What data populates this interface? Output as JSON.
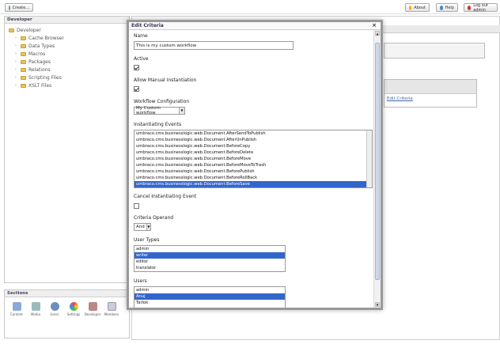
{
  "topbar": {
    "create_label": "Create...",
    "about_label": "About",
    "help_label": "Help",
    "logout_label": "Log out admin"
  },
  "left_panel": {
    "title": "Developer",
    "root": "Developer",
    "items": [
      "Cache Browser",
      "Data Types",
      "Macros",
      "Packages",
      "Relations",
      "Scripting Files",
      "XSLT Files"
    ]
  },
  "sections": {
    "title": "Sections",
    "items": [
      "Content",
      "Media",
      "Users",
      "Settings",
      "Developer",
      "Members"
    ]
  },
  "main": {
    "edit_link": "Edit Criteria"
  },
  "modal": {
    "title": "Edit Criteria",
    "close": "×",
    "name_label": "Name",
    "name_value": "This is my custom workflow",
    "active_label": "Active",
    "manual_label": "Allow Manual Instantiation",
    "config_label": "Workflow Configuration",
    "config_value": "My Custom workflow",
    "events_label": "Instantiating Events",
    "events": [
      "umbraco.cms.businesslogic.web.Document.AfterSendToPublish",
      "umbraco.cms.businesslogic.web.Document.AfterUnPublish",
      "umbraco.cms.businesslogic.web.Document.BeforeCopy",
      "umbraco.cms.businesslogic.web.Document.BeforeDelete",
      "umbraco.cms.businesslogic.web.Document.BeforeMove",
      "umbraco.cms.businesslogic.web.Document.BeforeMoveToTrash",
      "umbraco.cms.businesslogic.web.Document.BeforePublish",
      "umbraco.cms.businesslogic.web.Document.BeforeRollBack",
      "umbraco.cms.businesslogic.web.Document.BeforeSave"
    ],
    "cancel_label": "Cancel Instantiating Event",
    "operand_label": "Criteria Operand",
    "operand_value": "And",
    "user_types_label": "User Types",
    "user_types": [
      "admin",
      "writer",
      "editor",
      "translator"
    ],
    "users_label": "Users",
    "users": [
      "admin",
      "Anuj",
      "Tarlok"
    ]
  }
}
